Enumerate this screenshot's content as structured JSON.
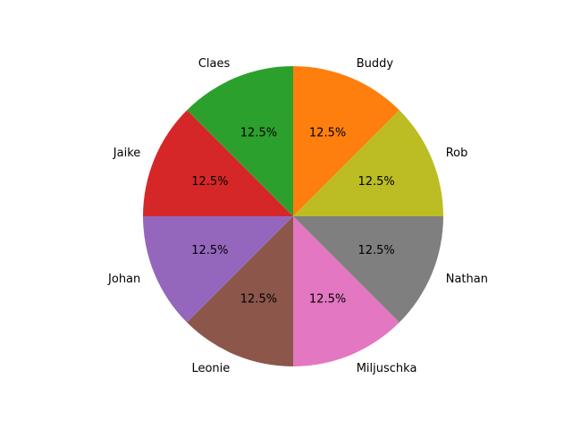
{
  "chart_data": {
    "type": "pie",
    "categories": [
      "Rob",
      "Buddy",
      "Claes",
      "Jaike",
      "Johan",
      "Leonie",
      "Miljuschka",
      "Nathan"
    ],
    "values": [
      12.5,
      12.5,
      12.5,
      12.5,
      12.5,
      12.5,
      12.5,
      12.5
    ],
    "value_labels": [
      "12.5%",
      "12.5%",
      "12.5%",
      "12.5%",
      "12.5%",
      "12.5%",
      "12.5%",
      "12.5%"
    ],
    "colors": [
      "#bcbd22",
      "#ff7f0e",
      "#2ca02c",
      "#d62728",
      "#9467bd",
      "#8c564b",
      "#e377c2",
      "#7f7f7f"
    ],
    "start_angle_deg": 0,
    "direction": "counterclockwise",
    "title": ""
  }
}
